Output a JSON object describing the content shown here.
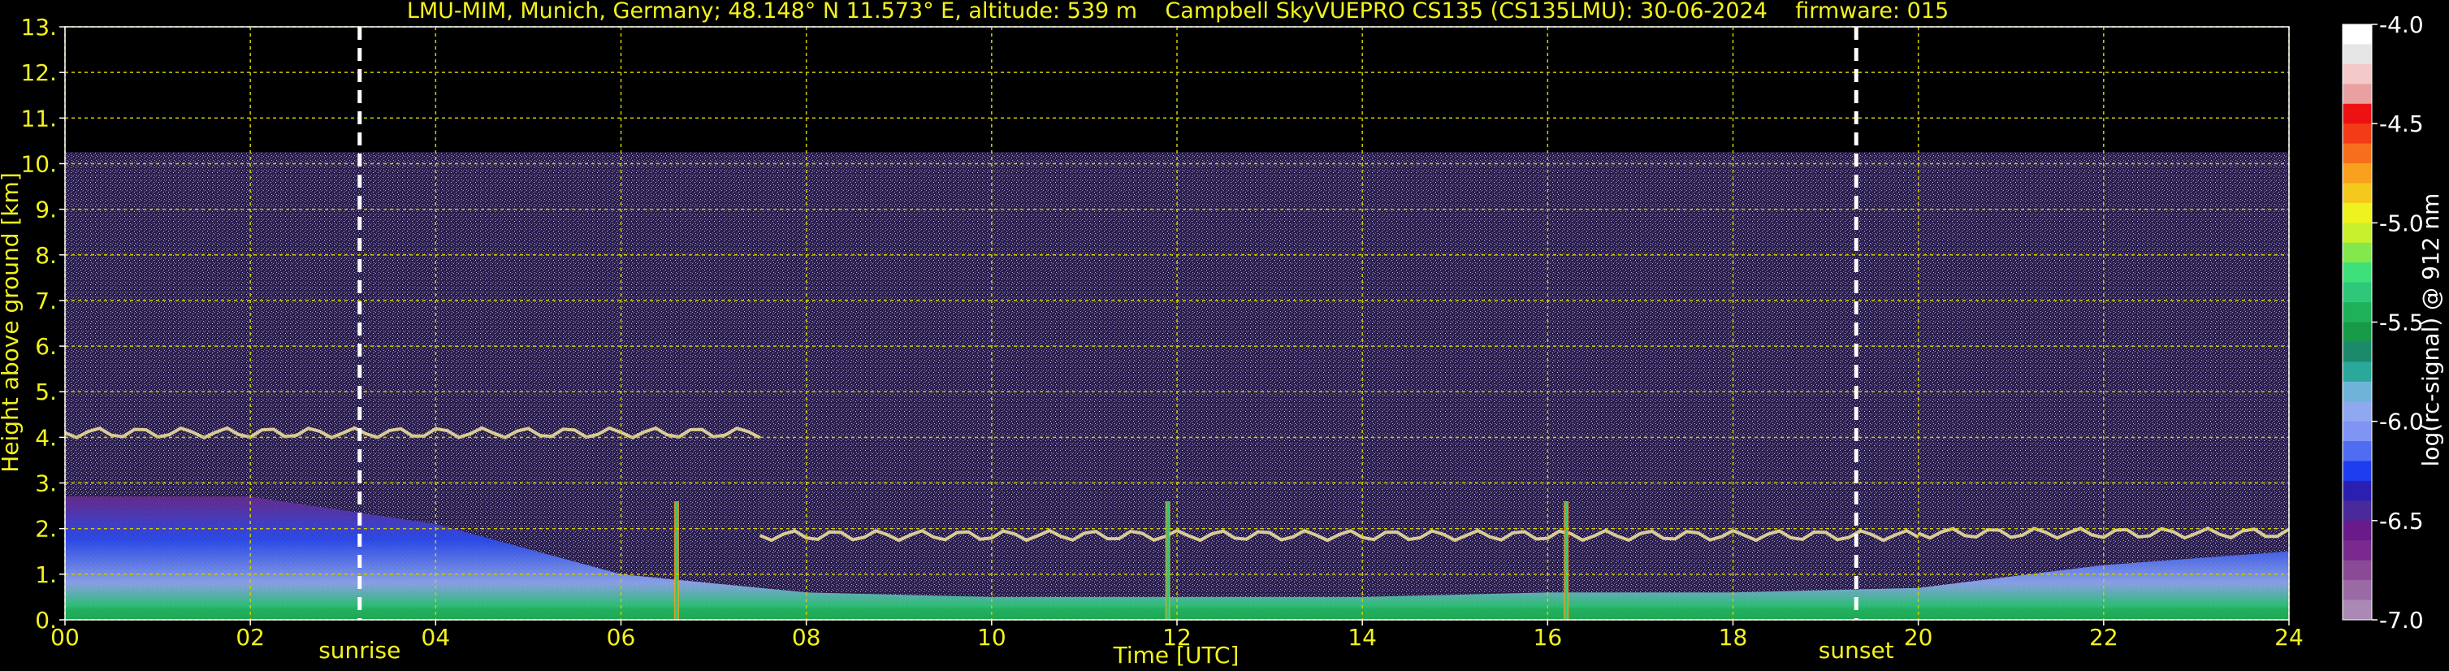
{
  "chart_data": {
    "type": "heatmap",
    "title": "LMU-MIM, Munich, Germany; 48.148° N 11.573° E, altitude: 539 m    Campbell SkyVUEPRO CS135 (CS135LMU): 30-06-2024    firmware: 015",
    "xlabel": "Time [UTC]",
    "ylabel": "Height above ground [km]",
    "xlim": [
      0,
      24
    ],
    "ylim": [
      0,
      13
    ],
    "x_ticks": [
      "00",
      "02",
      "04",
      "06",
      "08",
      "10",
      "12",
      "14",
      "16",
      "18",
      "20",
      "22",
      "24"
    ],
    "y_ticks": [
      "0.",
      "1.",
      "2.",
      "3.",
      "4.",
      "5.",
      "6.",
      "7.",
      "8.",
      "9.",
      "10.",
      "11.",
      "12.",
      "13."
    ],
    "grid": true,
    "annotations": [
      {
        "label": "sunrise",
        "x": 3.18
      },
      {
        "label": "sunset",
        "x": 19.33
      }
    ],
    "colorbar": {
      "label": "log(rc-signal) @ 912 nm",
      "range": [
        -7.0,
        -4.0
      ],
      "ticks": [
        "-4.0",
        "-4.5",
        "-5.0",
        "-5.5",
        "-6.0",
        "-6.5",
        "-7.0"
      ],
      "colors": [
        "#ffffff",
        "#e6e6e6",
        "#f4c8c8",
        "#e8a0a0",
        "#ee1111",
        "#f43b18",
        "#f76e1c",
        "#f9a01d",
        "#f5c81c",
        "#eef21e",
        "#c9f02c",
        "#82e84c",
        "#3ee07a",
        "#2fc87a",
        "#1fb05a",
        "#179a48",
        "#1a8a6a",
        "#2aa89a",
        "#6fb4d8",
        "#8fa8f0",
        "#7f94f4",
        "#4f6cf2",
        "#1e3cf0",
        "#2a1fb0",
        "#4a2a9a",
        "#6a1a8a",
        "#7a2a8e",
        "#8a4a96",
        "#9a6aa4",
        "#aa8ab4"
      ]
    },
    "features": [
      {
        "name": "boundary_layer_aerosol",
        "x_range": [
          0,
          24
        ],
        "top_km": [
          2.7,
          2.7,
          2.1,
          1.0,
          0.6,
          0.5,
          0.5,
          0.5,
          0.6,
          0.6,
          0.7,
          1.2,
          1.5
        ]
      },
      {
        "name": "cloud_layer_4km",
        "x_range": [
          0,
          7.5
        ],
        "height_km": 4.1
      },
      {
        "name": "cloud_layer_1.8km",
        "x_range": [
          7.5,
          20
        ],
        "height_km": 1.85
      },
      {
        "name": "cloud_layer_2km_evening",
        "x_range": [
          20,
          24
        ],
        "height_km": 1.9
      },
      {
        "name": "rain_streaks",
        "x": [
          6.6,
          11.9,
          16.2
        ]
      }
    ]
  }
}
